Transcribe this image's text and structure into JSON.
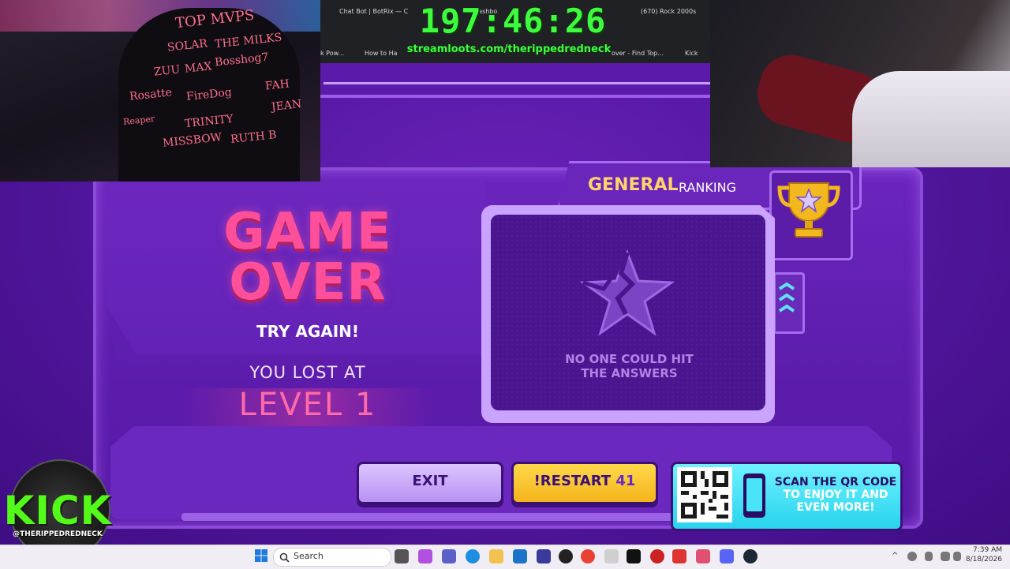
{
  "overlay": {
    "timer": "197:46:26",
    "streamloots_url": "streamloots.com/therippedredneck",
    "browser_tabs": [
      "Chat Bot | BotRix — C",
      "Dashbo",
      "(670) Rock 2000s"
    ],
    "bookmarks": [
      "k Pow...",
      "How to Ha",
      "over - Find Top...",
      "Kick"
    ],
    "top_mvps_title": "TOP MVPS",
    "mvp_names": [
      "SOLAR",
      "THE MILKS",
      "ZUU",
      "MAX",
      "Bosshog7",
      "FAH",
      "Rosatte",
      "FireDog",
      "JEAN",
      "Reaper",
      "TRINITY",
      "MISSBOW",
      "RUTH B"
    ]
  },
  "game": {
    "title_line1": "GAME",
    "title_line2": "OVER",
    "try_again": "TRY AGAIN!",
    "you_lost_at": "YOU LOST AT",
    "level": "LEVEL 1",
    "ranking": {
      "title": "GENERAL",
      "subtitle": "RANKING",
      "empty_message": "NO ONE COULD HIT THE ANSWERS"
    },
    "buttons": {
      "exit": "EXIT",
      "restart": "!RESTART",
      "restart_count": "41"
    },
    "qr": {
      "text_dark1": "SCAN THE QR CODE",
      "text_light": "TO ENJOY IT AND EVEN MORE!"
    }
  },
  "kick": {
    "logo": "KICK",
    "handle": "@THERIPPEDREDNECK"
  },
  "taskbar": {
    "search_placeholder": "Search",
    "time": "7:39 AM",
    "date": "8/18/2026"
  },
  "colors": {
    "game_over_pink": "#ff4f9a",
    "restart_yellow": "#f4b41b",
    "timer_green": "#3dff3d",
    "kick_green": "#53fc18",
    "qr_cyan": "#28d3ee"
  }
}
